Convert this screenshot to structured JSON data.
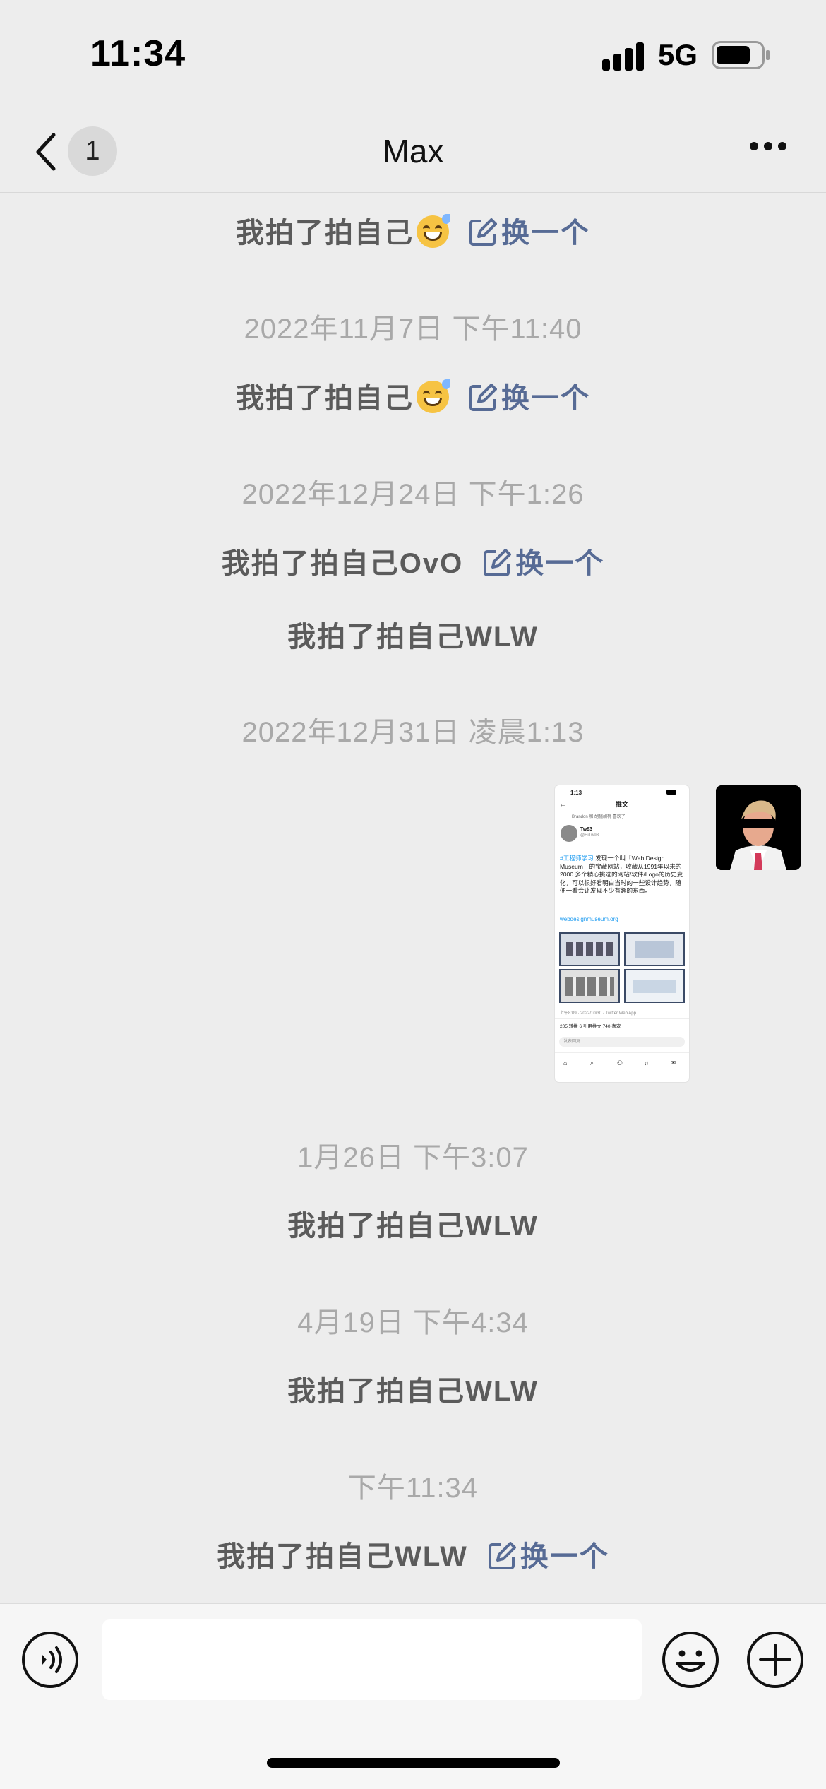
{
  "status_bar": {
    "time": "11:34",
    "network": "5G"
  },
  "nav": {
    "back_badge": "1",
    "title": "Max"
  },
  "messages": [
    {
      "text": "我拍了拍自己",
      "swap_label": "换一个"
    },
    {
      "timestamp": "2022年11月7日 下午11:40"
    },
    {
      "text": "我拍了拍自己",
      "swap_label": "换一个"
    },
    {
      "timestamp": "2022年12月24日 下午1:26"
    },
    {
      "text": "我拍了拍自己OvO",
      "swap_label": "换一个"
    },
    {
      "text": "我拍了拍自己WLW"
    },
    {
      "timestamp": "2022年12月31日 凌晨1:13"
    },
    {
      "timestamp": "1月26日 下午3:07"
    },
    {
      "text": "我拍了拍自己WLW"
    },
    {
      "timestamp": "4月19日 下午4:34"
    },
    {
      "text": "我拍了拍自己WLW"
    },
    {
      "timestamp": "下午11:34"
    },
    {
      "text": "我拍了拍自己WLW",
      "swap_label": "换一个"
    }
  ],
  "image_message": {
    "time": "1:13",
    "header": "推文",
    "retweeter": "Brandon 和 胡桃胡桃 喜欢了",
    "author_name": "Tw93",
    "author_handle": "@HiTw93",
    "hashtag": "#工程师学习",
    "body": "发现一个叫「Web Design Museum」的宝藏网站，收藏从1991年以来的 2000 多个精心挑选的网站/软件/Logo的历史变化，可以很好看明白当时的一些设计趋势，随便一看会让发现不少有趣的东西。",
    "link": "webdesignmuseum.org",
    "meta": "上午8:09 · 2022/10/30 · Twitter Web App",
    "stats": "205 转推  6 引用推文  740 喜欢",
    "reply": "发表回复"
  },
  "colors": {
    "link": "#576b95",
    "background": "#ededed"
  },
  "icons": [
    "signal-icon",
    "battery-icon",
    "chevron-left-icon",
    "more-icon",
    "voice-icon",
    "emoji-icon",
    "plus-icon",
    "edit-icon"
  ]
}
